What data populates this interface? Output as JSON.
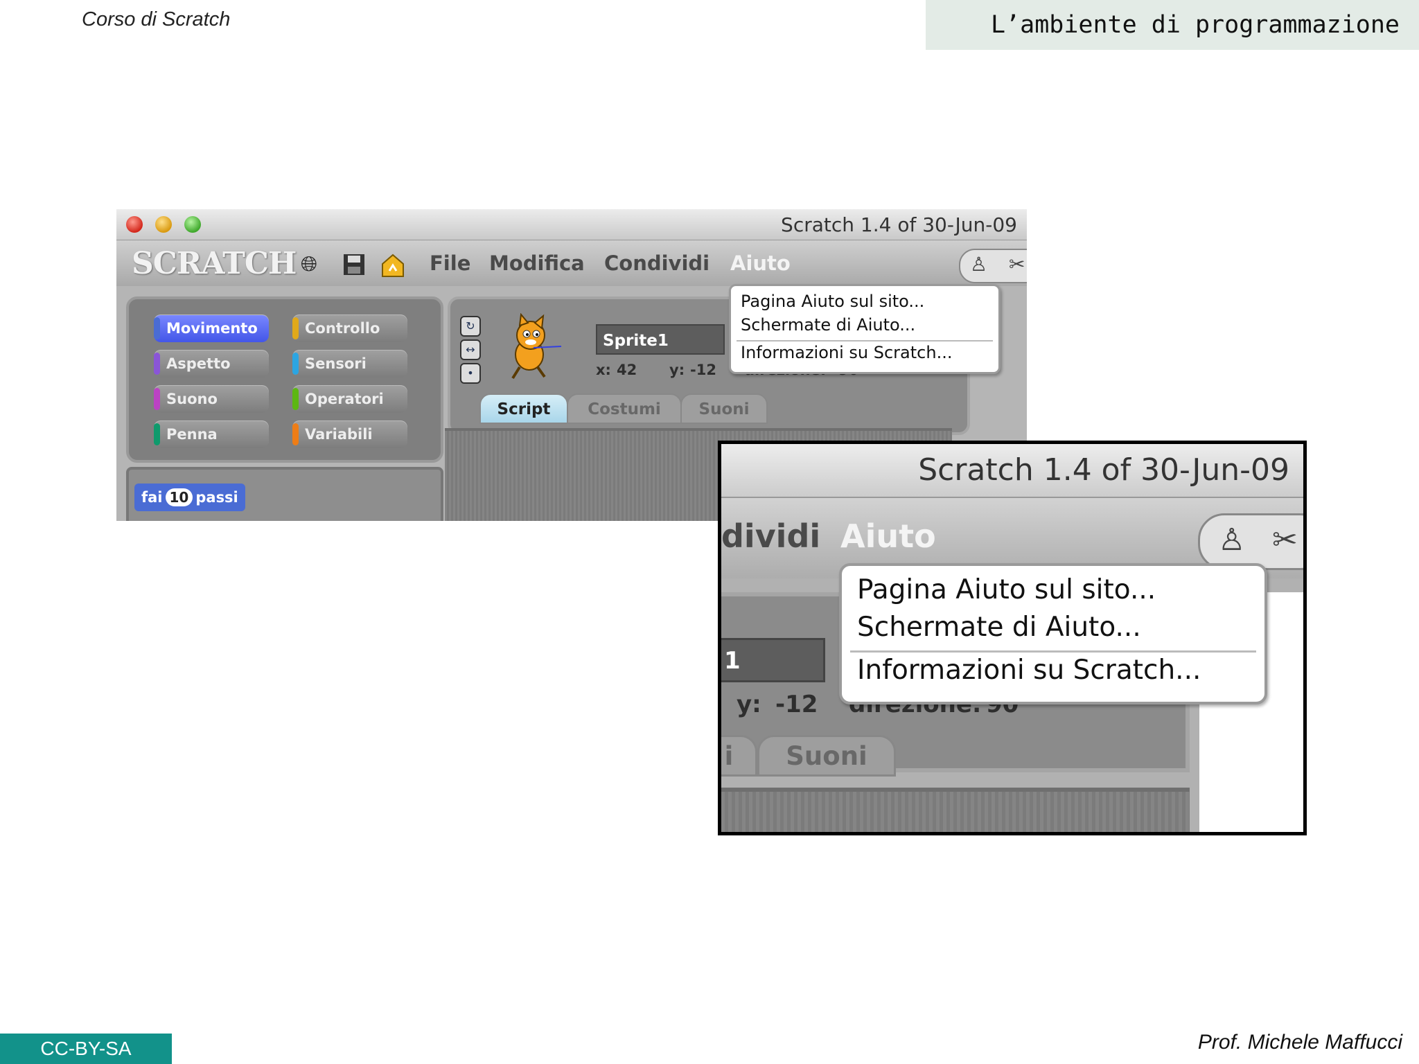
{
  "slide": {
    "course": "Corso di Scratch",
    "title": "L’ambiente di programmazione",
    "license": "CC-BY-SA",
    "author": "Prof. Michele Maffucci"
  },
  "window": {
    "title": "Scratch 1.4 of 30-Jun-09",
    "logo": "SCRATCH"
  },
  "toolbar_icons": [
    "globe-icon",
    "save-icon",
    "share-icon"
  ],
  "menus": {
    "file": "File",
    "edit": "Modifica",
    "share": "Condividi",
    "help": "Aiuto"
  },
  "help_menu": {
    "items": [
      "Pagina Aiuto sul sito...",
      "Schermate di Aiuto...",
      "Informazioni su Scratch..."
    ]
  },
  "categories": [
    {
      "label": "Movimento",
      "color": "#4a6cd4",
      "selected": true
    },
    {
      "label": "Aspetto",
      "color": "#8a55d7"
    },
    {
      "label": "Suono",
      "color": "#bb42c3"
    },
    {
      "label": "Penna",
      "color": "#0e9a6c"
    },
    {
      "label": "Controllo",
      "color": "#e1a91a"
    },
    {
      "label": "Sensori",
      "color": "#2ca5e2"
    },
    {
      "label": "Operatori",
      "color": "#5cb712"
    },
    {
      "label": "Variabili",
      "color": "#ee7d16"
    }
  ],
  "block": {
    "prefix": "fai",
    "value": "10",
    "suffix": "passi"
  },
  "sprite": {
    "name": "Sprite1",
    "x_label": "x:",
    "x": "42",
    "y_label": "y:",
    "y": "-12",
    "direction_label": "direzione:",
    "direction": "90"
  },
  "tabs": [
    "Script",
    "Costumi",
    "Suoni"
  ],
  "zoom": {
    "menu_partial": "dividi",
    "name_partial": "1",
    "tab_partial": "i"
  }
}
